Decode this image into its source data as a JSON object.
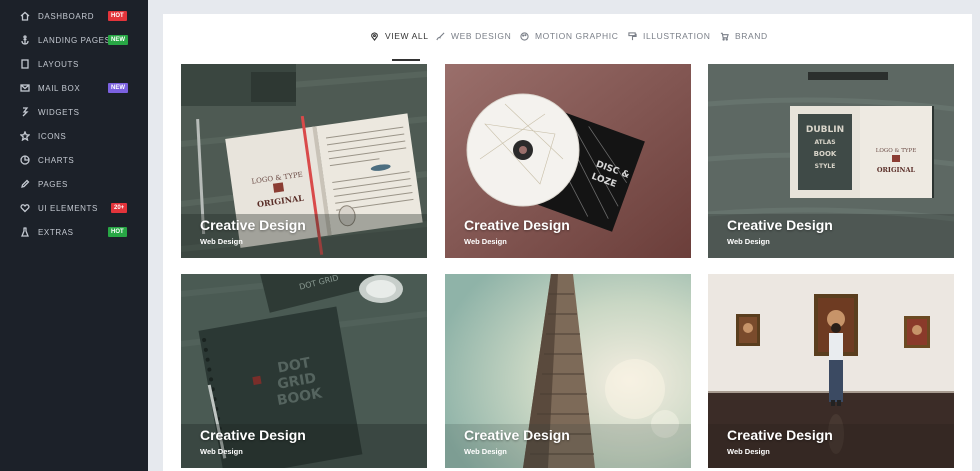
{
  "sidebar": {
    "items": [
      {
        "label": "DASHBOARD",
        "icon": "home-icon",
        "badge": "HOT",
        "badge_color": "#e3343b"
      },
      {
        "label": "LANDING PAGES",
        "icon": "anchor-icon",
        "badge": "NEW",
        "badge_color": "#28a745"
      },
      {
        "label": "LAYOUTS",
        "icon": "layout-icon",
        "badge": null
      },
      {
        "label": "MAIL BOX",
        "icon": "mail-icon",
        "badge": "NEW",
        "badge_color": "#7b61e0"
      },
      {
        "label": "WIDGETS",
        "icon": "widget-icon",
        "badge": null
      },
      {
        "label": "ICONS",
        "icon": "star-icon",
        "badge": null
      },
      {
        "label": "CHARTS",
        "icon": "pie-chart-icon",
        "badge": null
      },
      {
        "label": "PAGES",
        "icon": "pencil-icon",
        "badge": null
      },
      {
        "label": "UI ELEMENTS",
        "icon": "heart-icon",
        "badge": "20+",
        "badge_color": "#e3343b"
      },
      {
        "label": "EXTRAS",
        "icon": "flask-icon",
        "badge": "HOT",
        "badge_color": "#28a745"
      }
    ]
  },
  "filters": {
    "active": "VIEW All",
    "tabs": [
      {
        "label": "VIEW All",
        "icon": "map-pin-icon"
      },
      {
        "label": "WEB DESIGN",
        "icon": "brush-icon"
      },
      {
        "label": "MOTION GRAPHIC",
        "icon": "palette-icon"
      },
      {
        "label": "ILLUSTRATION",
        "icon": "paint-roller-icon"
      },
      {
        "label": "BRAND",
        "icon": "cart-icon"
      }
    ]
  },
  "portfolio": {
    "items": [
      {
        "title": "Creative Design",
        "category": "Web Design",
        "image": "notebook-logo-mockup"
      },
      {
        "title": "Creative Design",
        "category": "Web Design",
        "image": "cd-disc-mockup"
      },
      {
        "title": "Creative Design",
        "category": "Web Design",
        "image": "book-cover-mockup"
      },
      {
        "title": "Creative Design",
        "category": "Web Design",
        "image": "dot-grid-notebook"
      },
      {
        "title": "Creative Design",
        "category": "Web Design",
        "image": "flatiron-building"
      },
      {
        "title": "Creative Design",
        "category": "Web Design",
        "image": "gallery-visitor"
      }
    ]
  }
}
